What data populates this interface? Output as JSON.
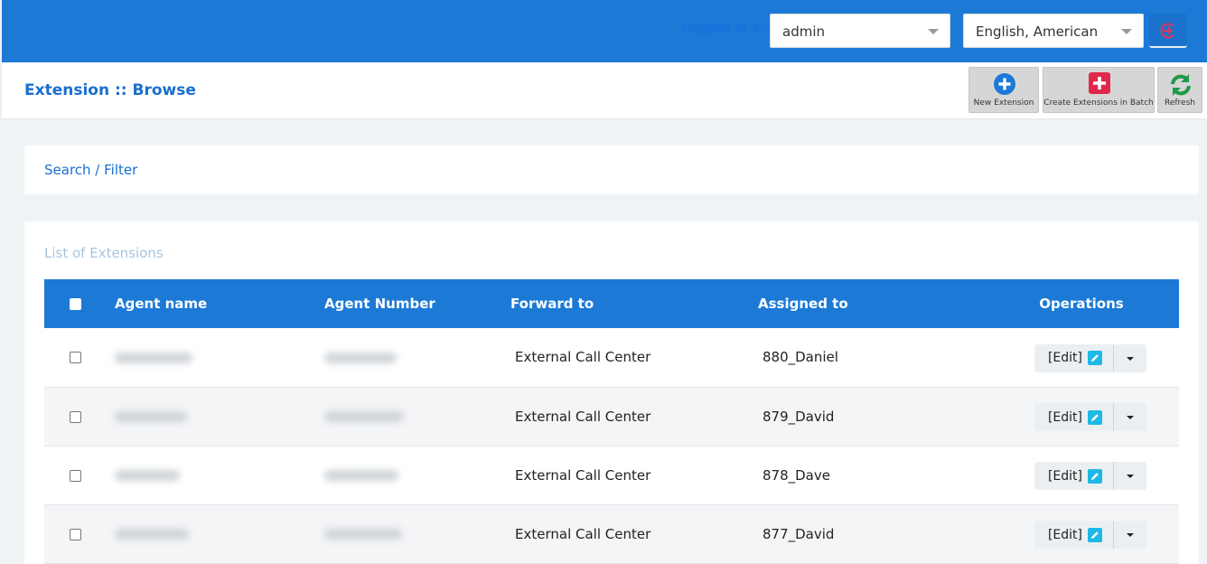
{
  "topbar": {
    "logged_in_label": "Logged in as:",
    "user_select_value": "admin",
    "language_select_value": "English, American",
    "brand_color": "#1c7ad6"
  },
  "header": {
    "title": "Extension :: Browse",
    "toolbar": {
      "new_extension_label": "New Extension",
      "create_batch_label": "Create Extensions in Batch",
      "refresh_label": "Refresh"
    }
  },
  "search": {
    "label": "Search / Filter"
  },
  "list": {
    "title": "List of Extensions",
    "columns": [
      "Agent name",
      "Agent Number",
      "Forward to",
      "Assigned to",
      "Operations"
    ],
    "rows": [
      {
        "forward_to": "External Call Center",
        "assigned_to": "880_Daniel",
        "edit_label": "[Edit]"
      },
      {
        "forward_to": "External Call Center",
        "assigned_to": "879_David",
        "edit_label": "[Edit]"
      },
      {
        "forward_to": "External Call Center",
        "assigned_to": "878_Dave",
        "edit_label": "[Edit]"
      },
      {
        "forward_to": "External Call Center",
        "assigned_to": "877_David",
        "edit_label": "[Edit]"
      }
    ]
  },
  "icons": {
    "logout": "logout-icon",
    "new_extension": "plus-circle-icon",
    "create_batch": "plus-square-icon",
    "refresh": "refresh-icon",
    "edit": "pencil-icon"
  }
}
